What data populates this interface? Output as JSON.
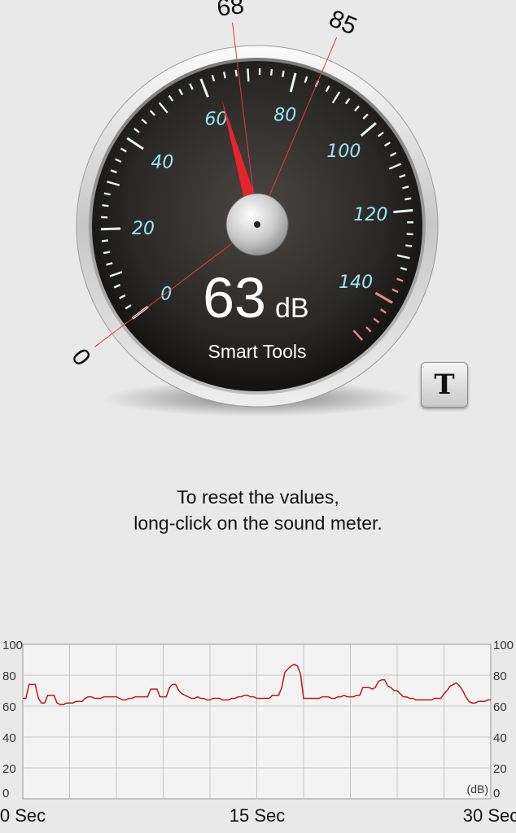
{
  "meter": {
    "current_value": 63,
    "unit": "dB",
    "brand": "Smart Tools",
    "min_marker": "0",
    "avg_marker": "68",
    "max_marker": "85",
    "dial_labels": [
      "0",
      "20",
      "40",
      "60",
      "80",
      "100",
      "120",
      "140"
    ],
    "needle_color": "#e8232a",
    "tick_label_color": "#9be7f3"
  },
  "tools": {
    "text_button_label": "T"
  },
  "hint": {
    "line1": "To reset the values,",
    "line2": "long-click on the sound meter."
  },
  "chart_data": {
    "type": "line",
    "title": "",
    "xlabel": "",
    "ylabel": "(dB)",
    "y_unit": "(dB)",
    "ylim": [
      0,
      100
    ],
    "xlim": [
      0,
      30
    ],
    "y_ticks": [
      "0",
      "20",
      "40",
      "60",
      "80",
      "100"
    ],
    "x_ticks": [
      "0 Sec",
      "15 Sec",
      "30 Sec"
    ],
    "grid": true,
    "series": [
      {
        "color": "#c0161d",
        "x": [
          0,
          0.2,
          0.4,
          0.6,
          0.8,
          1.0,
          1.2,
          1.4,
          1.6,
          1.8,
          2.0,
          2.2,
          2.4,
          2.6,
          2.8,
          3.0,
          3.2,
          3.4,
          3.6,
          3.8,
          4.0,
          4.2,
          4.4,
          4.6,
          4.8,
          5.0,
          5.2,
          5.4,
          5.6,
          5.8,
          6.0,
          6.2,
          6.4,
          6.6,
          6.8,
          7.0,
          7.2,
          7.4,
          7.6,
          7.8,
          8.0,
          8.2,
          8.4,
          8.6,
          8.8,
          9.0,
          9.2,
          9.4,
          9.6,
          9.8,
          10.0,
          10.2,
          10.4,
          10.6,
          10.8,
          11.0,
          11.2,
          11.4,
          11.6,
          11.8,
          12.0,
          12.2,
          12.4,
          12.6,
          12.8,
          13.0,
          13.2,
          13.4,
          13.6,
          13.8,
          14.0,
          14.2,
          14.4,
          14.6,
          14.8,
          15.0,
          15.2,
          15.4,
          15.6,
          15.8,
          16.0,
          16.2,
          16.4,
          16.6,
          16.8,
          17.0,
          17.2,
          17.4,
          17.6,
          17.8,
          18.0,
          18.2,
          18.4,
          18.6,
          18.8,
          19.0,
          19.2,
          19.4,
          19.6,
          19.8,
          20.0,
          20.2,
          20.4,
          20.6,
          20.8,
          21.0,
          21.2,
          21.4,
          21.6,
          21.8,
          22.0,
          22.2,
          22.4,
          22.6,
          22.8,
          23.0,
          23.2,
          23.4,
          23.6,
          23.8,
          24.0,
          24.2,
          24.4,
          24.6,
          24.8,
          25.0,
          25.2,
          25.4,
          25.6,
          25.8,
          26.0,
          26.2,
          26.4,
          26.6,
          26.8,
          27.0,
          27.2,
          27.4,
          27.6,
          27.8,
          28.0,
          28.2,
          28.4,
          28.6,
          28.8,
          29.0,
          29.2,
          29.4,
          29.6,
          29.8,
          30.0
        ],
        "values": [
          65,
          65,
          74,
          74,
          74,
          65,
          62,
          62,
          67,
          67,
          67,
          62,
          61,
          61,
          62,
          62,
          62,
          63,
          63,
          63,
          65,
          66,
          66,
          65,
          65,
          65,
          66,
          66,
          66,
          66,
          66,
          65,
          64,
          64,
          65,
          65,
          66,
          66,
          66,
          66,
          66,
          71,
          71,
          71,
          66,
          66,
          66,
          72,
          74,
          74,
          70,
          68,
          67,
          66,
          65,
          65,
          66,
          65,
          65,
          64,
          64,
          65,
          65,
          65,
          64,
          64,
          64,
          65,
          65,
          66,
          66,
          67,
          67,
          66,
          66,
          65,
          65,
          65,
          65,
          65,
          67,
          67,
          67,
          72,
          82,
          84,
          86,
          87,
          86,
          81,
          65,
          65,
          65,
          65,
          65,
          65,
          66,
          66,
          66,
          65,
          65,
          66,
          66,
          67,
          66,
          66,
          66,
          67,
          67,
          72,
          72,
          72,
          71,
          72,
          76,
          77,
          77,
          73,
          72,
          70,
          70,
          68,
          66,
          66,
          65,
          65,
          64,
          64,
          64,
          64,
          64,
          64,
          65,
          65,
          65,
          68,
          70,
          73,
          74,
          75,
          73,
          70,
          66,
          63,
          62,
          62,
          63,
          63,
          63,
          64,
          64
        ]
      }
    ]
  }
}
